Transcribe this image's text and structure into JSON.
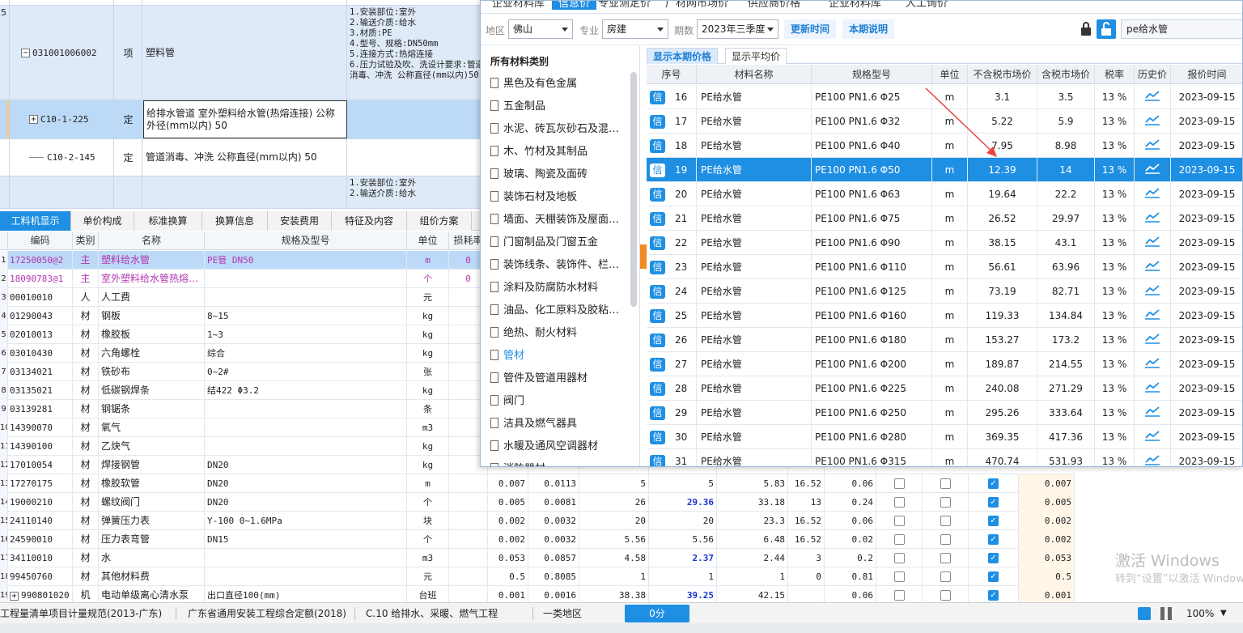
{
  "top_rows": [
    {
      "idx": "",
      "code": "",
      "unit": "",
      "name": "",
      "desc": ""
    },
    {
      "idx": "5",
      "code": "031001006002",
      "unit": "项",
      "name": "塑料管",
      "desc": "1.安装部位:室外\n2.输送介质:给水\n3.材质:PE\n4.型号、规格:DN50mm\n5.连接方式:热熔连接\n6.压力试验及吹、洗设计要求:管道消毒、冲洗 公称直径(mm以内)50"
    },
    {
      "idx": "",
      "code": "C10-1-225",
      "unit": "定",
      "name": "给排水管道 室外塑料给水管(热熔连接) 公称外径(mm以内) 50",
      "desc": ""
    },
    {
      "idx": "",
      "code": "C10-2-145",
      "unit": "定",
      "name": "管道消毒、冲洗 公称直径(mm以内) 50",
      "desc": ""
    },
    {
      "idx": "",
      "code": "",
      "unit": "",
      "name": "",
      "desc": "1.安装部位:室外\n2.输送介质:给水"
    }
  ],
  "tabs": [
    "工料机显示",
    "单价构成",
    "标准换算",
    "换算信息",
    "安装费用",
    "特征及内容",
    "组价方案"
  ],
  "grid": {
    "headers": [
      "编码",
      "类别",
      "名称",
      "规格及型号",
      "单位",
      "损耗率"
    ],
    "rows": [
      {
        "n": "1",
        "code": "17250050@2",
        "cat": "主",
        "name": "塑料给水管",
        "spec": "PE管 DN50",
        "unit": "m",
        "loss": "0",
        "v": [
          "",
          "",
          "",
          "",
          "",
          "",
          "",
          "",
          ""
        ],
        "c": [
          0,
          0,
          0
        ],
        "style": "main"
      },
      {
        "n": "2",
        "code": "18090783@1",
        "cat": "主",
        "name": "室外塑料给水管热熔…",
        "spec": "",
        "unit": "个",
        "loss": "0",
        "v": [
          "",
          "",
          "",
          "",
          "",
          "",
          "",
          "",
          ""
        ],
        "c": [
          0,
          0,
          0
        ],
        "style": "main"
      },
      {
        "n": "3",
        "code": "00010010",
        "cat": "人",
        "name": "人工费",
        "spec": "",
        "unit": "元",
        "loss": "",
        "v": [
          "",
          "",
          "",
          "",
          "",
          "",
          "",
          "",
          ""
        ],
        "c": [
          0,
          0,
          0
        ],
        "style": ""
      },
      {
        "n": "4",
        "code": "01290043",
        "cat": "材",
        "name": "钢板",
        "spec": "8~15",
        "unit": "kg",
        "loss": "",
        "v": [
          "",
          "",
          "",
          "",
          "",
          "",
          "",
          "",
          ""
        ],
        "c": [
          0,
          0,
          0
        ],
        "style": ""
      },
      {
        "n": "5",
        "code": "02010013",
        "cat": "材",
        "name": "橡胶板",
        "spec": "1~3",
        "unit": "kg",
        "loss": "",
        "v": [
          "",
          "",
          "",
          "",
          "",
          "",
          "",
          "",
          ""
        ],
        "c": [
          0,
          0,
          0
        ],
        "style": ""
      },
      {
        "n": "6",
        "code": "03010430",
        "cat": "材",
        "name": "六角螺栓",
        "spec": "综合",
        "unit": "kg",
        "loss": "",
        "v": [
          "",
          "",
          "",
          "",
          "",
          "",
          "",
          "",
          ""
        ],
        "c": [
          0,
          0,
          0
        ],
        "style": ""
      },
      {
        "n": "7",
        "code": "03134021",
        "cat": "材",
        "name": "铁砂布",
        "spec": "0~2#",
        "unit": "张",
        "loss": "",
        "v": [
          "",
          "",
          "",
          "",
          "",
          "",
          "",
          "",
          ""
        ],
        "c": [
          0,
          0,
          0
        ],
        "style": ""
      },
      {
        "n": "8",
        "code": "03135021",
        "cat": "材",
        "name": "低碳钢焊条",
        "spec": "结422 Φ3.2",
        "unit": "kg",
        "loss": "",
        "v": [
          "",
          "",
          "",
          "",
          "",
          "",
          "",
          "",
          ""
        ],
        "c": [
          0,
          0,
          0
        ],
        "style": ""
      },
      {
        "n": "9",
        "code": "03139281",
        "cat": "材",
        "name": "钢锯条",
        "spec": "",
        "unit": "条",
        "loss": "",
        "v": [
          "",
          "",
          "",
          "",
          "",
          "",
          "",
          "",
          ""
        ],
        "c": [
          0,
          0,
          0
        ],
        "style": ""
      },
      {
        "n": "10",
        "code": "14390070",
        "cat": "材",
        "name": "氧气",
        "spec": "",
        "unit": "m3",
        "loss": "",
        "v": [
          "",
          "",
          "",
          "",
          "",
          "",
          "",
          "",
          ""
        ],
        "c": [
          0,
          0,
          0
        ],
        "style": ""
      },
      {
        "n": "11",
        "code": "14390100",
        "cat": "材",
        "name": "乙炔气",
        "spec": "",
        "unit": "kg",
        "loss": "",
        "v": [
          "",
          "",
          "",
          "",
          "",
          "",
          "",
          "",
          ""
        ],
        "c": [
          0,
          0,
          0
        ],
        "style": ""
      },
      {
        "n": "12",
        "code": "17010054",
        "cat": "材",
        "name": "焊接钢管",
        "spec": "DN20",
        "unit": "kg",
        "loss": "",
        "v": [
          "",
          "",
          "",
          "",
          "",
          "",
          "",
          "",
          ""
        ],
        "c": [
          0,
          0,
          0
        ],
        "style": ""
      },
      {
        "n": "13",
        "code": "17270175",
        "cat": "材",
        "name": "橡胶软管",
        "spec": "DN20",
        "unit": "m",
        "loss": "",
        "v": [
          "0.007",
          "0.0113",
          "5",
          "5",
          "5.83",
          "16.52",
          "0.06",
          "",
          "0.007"
        ],
        "c": [
          0,
          0,
          1
        ],
        "style": ""
      },
      {
        "n": "14",
        "code": "19000210",
        "cat": "材",
        "name": "螺纹阀门",
        "spec": "DN20",
        "unit": "个",
        "loss": "",
        "v": [
          "0.005",
          "0.0081",
          "26",
          "29.36",
          "33.18",
          "13",
          "0.24",
          "",
          "0.005"
        ],
        "c": [
          0,
          0,
          1
        ],
        "style": "b3"
      },
      {
        "n": "15",
        "code": "24110140",
        "cat": "材",
        "name": "弹簧压力表",
        "spec": "Y-100 0~1.6MPa",
        "unit": "块",
        "loss": "",
        "v": [
          "0.002",
          "0.0032",
          "20",
          "20",
          "23.3",
          "16.52",
          "0.06",
          "",
          "0.002"
        ],
        "c": [
          0,
          0,
          1
        ],
        "style": ""
      },
      {
        "n": "16",
        "code": "24590010",
        "cat": "材",
        "name": "压力表弯管",
        "spec": "DN15",
        "unit": "个",
        "loss": "",
        "v": [
          "0.002",
          "0.0032",
          "5.56",
          "5.56",
          "6.48",
          "16.52",
          "0.02",
          "",
          "0.002"
        ],
        "c": [
          0,
          0,
          1
        ],
        "style": ""
      },
      {
        "n": "17",
        "code": "34110010",
        "cat": "材",
        "name": "水",
        "spec": "",
        "unit": "m3",
        "loss": "",
        "v": [
          "0.053",
          "0.0857",
          "4.58",
          "2.37",
          "2.44",
          "3",
          "0.2",
          "",
          "0.053"
        ],
        "c": [
          0,
          0,
          1
        ],
        "style": "b3"
      },
      {
        "n": "18",
        "code": "99450760",
        "cat": "材",
        "name": "其他材料费",
        "spec": "",
        "unit": "元",
        "loss": "",
        "v": [
          "0.5",
          "0.8085",
          "1",
          "1",
          "1",
          "0",
          "0.81",
          "",
          "0.5"
        ],
        "c": [
          0,
          0,
          1
        ],
        "style": ""
      },
      {
        "n": "19",
        "code": "990801020",
        "cat": "机",
        "name": "电动单级离心清水泵",
        "spec": "出口直径100(mm)",
        "unit": "台班",
        "loss": "",
        "v": [
          "0.001",
          "0.0016",
          "38.38",
          "39.25",
          "42.15",
          "",
          "0.06",
          "",
          "0.001"
        ],
        "c": [
          0,
          0,
          1
        ],
        "style": "b3"
      }
    ]
  },
  "status": {
    "items": [
      "工程量清单项目计量规范(2013-广东)",
      "广东省通用安装工程综合定额(2018)",
      "C.10 给排水、采暖、燃气工程",
      "一类地区"
    ],
    "score": "0分",
    "zoom": "100%"
  },
  "panel": {
    "topnav": [
      "企业材料库",
      "信息价",
      "专业测定价",
      "广材网市场价",
      "供应商价格",
      "企业材料库",
      "人工询价"
    ],
    "filters": {
      "region_label": "地区",
      "region": "佛山",
      "major_label": "专业",
      "major": "房建",
      "period_label": "期数",
      "period": "2023年三季度",
      "update_btn": "更新时间",
      "explain_btn": "本期说明",
      "search_value": "pe给水管"
    },
    "cat_title": "所有材料类别",
    "categories": [
      "黑色及有色金属",
      "五金制品",
      "水泥、砖瓦灰砂石及混…",
      "木、竹材及其制品",
      "玻璃、陶瓷及面砖",
      "装饰石材及地板",
      "墙面、天棚装饰及屋面…",
      "门窗制品及门窗五金",
      "装饰线条、装饰件、栏…",
      "涂料及防腐防水材料",
      "油品、化工原料及胶粘…",
      "绝热、耐火材料",
      "管材",
      "管件及管道用器材",
      "阀门",
      "洁具及燃气器具",
      "水暖及通风空调器材",
      "消防器材"
    ],
    "selected_category": "管材",
    "price_tabs": [
      "显示本期价格",
      "显示平均价"
    ],
    "table_headers": [
      "序号",
      "材料名称",
      "规格型号",
      "单位",
      "不含税市场价",
      "含税市场价",
      "税率",
      "历史价",
      "报价时间"
    ],
    "badge": "信",
    "rows": [
      {
        "no": "16",
        "name": "PE给水管",
        "spec": "PE100 PN1.6 Φ25",
        "unit": "m",
        "p1": "3.1",
        "p2": "3.5",
        "tax": "13 %",
        "date": "2023-09-15"
      },
      {
        "no": "17",
        "name": "PE给水管",
        "spec": "PE100 PN1.6 Φ32",
        "unit": "m",
        "p1": "5.22",
        "p2": "5.9",
        "tax": "13 %",
        "date": "2023-09-15"
      },
      {
        "no": "18",
        "name": "PE给水管",
        "spec": "PE100 PN1.6 Φ40",
        "unit": "m",
        "p1": "7.95",
        "p2": "8.98",
        "tax": "13 %",
        "date": "2023-09-15"
      },
      {
        "no": "19",
        "name": "PE给水管",
        "spec": "PE100 PN1.6 Φ50",
        "unit": "m",
        "p1": "12.39",
        "p2": "14",
        "tax": "13 %",
        "date": "2023-09-15"
      },
      {
        "no": "20",
        "name": "PE给水管",
        "spec": "PE100 PN1.6 Φ63",
        "unit": "m",
        "p1": "19.64",
        "p2": "22.2",
        "tax": "13 %",
        "date": "2023-09-15"
      },
      {
        "no": "21",
        "name": "PE给水管",
        "spec": "PE100 PN1.6 Φ75",
        "unit": "m",
        "p1": "26.52",
        "p2": "29.97",
        "tax": "13 %",
        "date": "2023-09-15"
      },
      {
        "no": "22",
        "name": "PE给水管",
        "spec": "PE100 PN1.6 Φ90",
        "unit": "m",
        "p1": "38.15",
        "p2": "43.1",
        "tax": "13 %",
        "date": "2023-09-15"
      },
      {
        "no": "23",
        "name": "PE给水管",
        "spec": "PE100 PN1.6 Φ110",
        "unit": "m",
        "p1": "56.61",
        "p2": "63.96",
        "tax": "13 %",
        "date": "2023-09-15"
      },
      {
        "no": "24",
        "name": "PE给水管",
        "spec": "PE100 PN1.6 Φ125",
        "unit": "m",
        "p1": "73.19",
        "p2": "82.71",
        "tax": "13 %",
        "date": "2023-09-15"
      },
      {
        "no": "25",
        "name": "PE给水管",
        "spec": "PE100 PN1.6 Φ160",
        "unit": "m",
        "p1": "119.33",
        "p2": "134.84",
        "tax": "13 %",
        "date": "2023-09-15"
      },
      {
        "no": "26",
        "name": "PE给水管",
        "spec": "PE100 PN1.6 Φ180",
        "unit": "m",
        "p1": "153.27",
        "p2": "173.2",
        "tax": "13 %",
        "date": "2023-09-15"
      },
      {
        "no": "27",
        "name": "PE给水管",
        "spec": "PE100 PN1.6 Φ200",
        "unit": "m",
        "p1": "189.87",
        "p2": "214.55",
        "tax": "13 %",
        "date": "2023-09-15"
      },
      {
        "no": "28",
        "name": "PE给水管",
        "spec": "PE100 PN1.6 Φ225",
        "unit": "m",
        "p1": "240.08",
        "p2": "271.29",
        "tax": "13 %",
        "date": "2023-09-15"
      },
      {
        "no": "29",
        "name": "PE给水管",
        "spec": "PE100 PN1.6 Φ250",
        "unit": "m",
        "p1": "295.26",
        "p2": "333.64",
        "tax": "13 %",
        "date": "2023-09-15"
      },
      {
        "no": "30",
        "name": "PE给水管",
        "spec": "PE100 PN1.6 Φ280",
        "unit": "m",
        "p1": "369.35",
        "p2": "417.36",
        "tax": "13 %",
        "date": "2023-09-15"
      },
      {
        "no": "31",
        "name": "PE给水管",
        "spec": "PE100 PN1.6 Φ315",
        "unit": "m",
        "p1": "470.74",
        "p2": "531.93",
        "tax": "13 %",
        "date": "2023-09-15"
      }
    ],
    "selected_row_no": "19"
  },
  "watermark": {
    "line1": "激活 Windows",
    "line2": "转到“设置”以激活 Windows。"
  },
  "colors": {
    "accent": "#1e8fe3",
    "highlight_row": "#bcd9f7",
    "main_material": "#b236b0",
    "arrow": "#e8453c"
  }
}
